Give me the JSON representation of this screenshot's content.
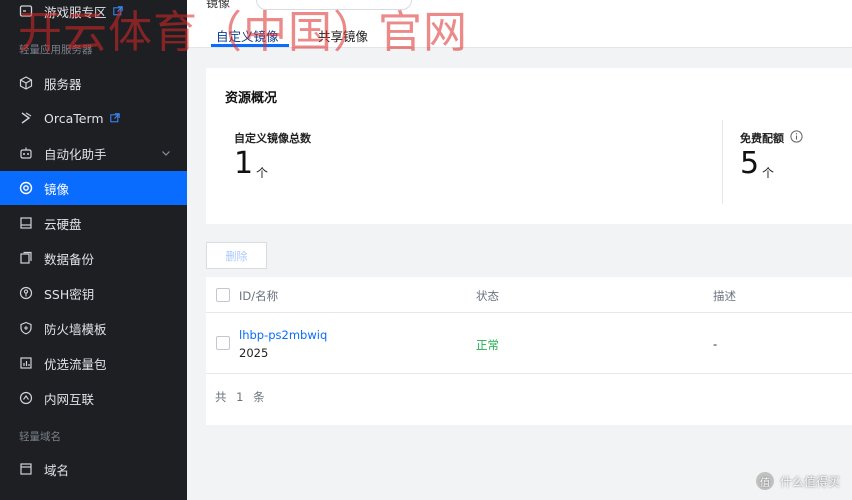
{
  "sidebar": {
    "items": [
      {
        "label": "游戏服专区",
        "icon": "game-server-icon",
        "external": true
      },
      {
        "label": "服务器",
        "icon": "cube-icon"
      },
      {
        "label": "OrcaTerm",
        "icon": "terminal-icon",
        "external": true
      },
      {
        "label": "自动化助手",
        "icon": "robot-icon",
        "expandable": true
      },
      {
        "label": "镜像",
        "icon": "image-ring-icon",
        "active": true
      },
      {
        "label": "云硬盘",
        "icon": "disk-icon"
      },
      {
        "label": "数据备份",
        "icon": "backup-icon"
      },
      {
        "label": "SSH密钥",
        "icon": "key-icon"
      },
      {
        "label": "防火墙模板",
        "icon": "shield-icon"
      },
      {
        "label": "优选流量包",
        "icon": "traffic-icon"
      },
      {
        "label": "内网互联",
        "icon": "network-icon"
      },
      {
        "label": "域名",
        "icon": "domain-icon"
      }
    ],
    "groups": {
      "lighthouse": "轻量应用服务器",
      "domain": "轻量域名"
    }
  },
  "header": {
    "crumb": "镜像"
  },
  "tabs": [
    {
      "label": "自定义镜像",
      "active": true
    },
    {
      "label": "共享镜像",
      "active": false
    }
  ],
  "overview": {
    "title": "资源概况",
    "stats": [
      {
        "label": "自定义镜像总数",
        "value": "1",
        "unit": "个"
      },
      {
        "label": "免费配额",
        "value": "5",
        "unit": "个",
        "info": true
      }
    ]
  },
  "toolbar": {
    "delete_label": "删除"
  },
  "table": {
    "columns": [
      "ID/名称",
      "状态",
      "描述"
    ],
    "rows": [
      {
        "id": "lhbp-ps2mbwiq",
        "name": "2025",
        "status": "正常",
        "description": "-"
      }
    ],
    "footer": "共 1 条"
  },
  "watermark": {
    "text": "开云体育（中国）官网",
    "corner": "什么值得买",
    "corner_logo": "值"
  },
  "colors": {
    "accent": "#0a6cff",
    "sidebar_bg": "#1d1f23",
    "status_ok": "#1fae4f"
  }
}
